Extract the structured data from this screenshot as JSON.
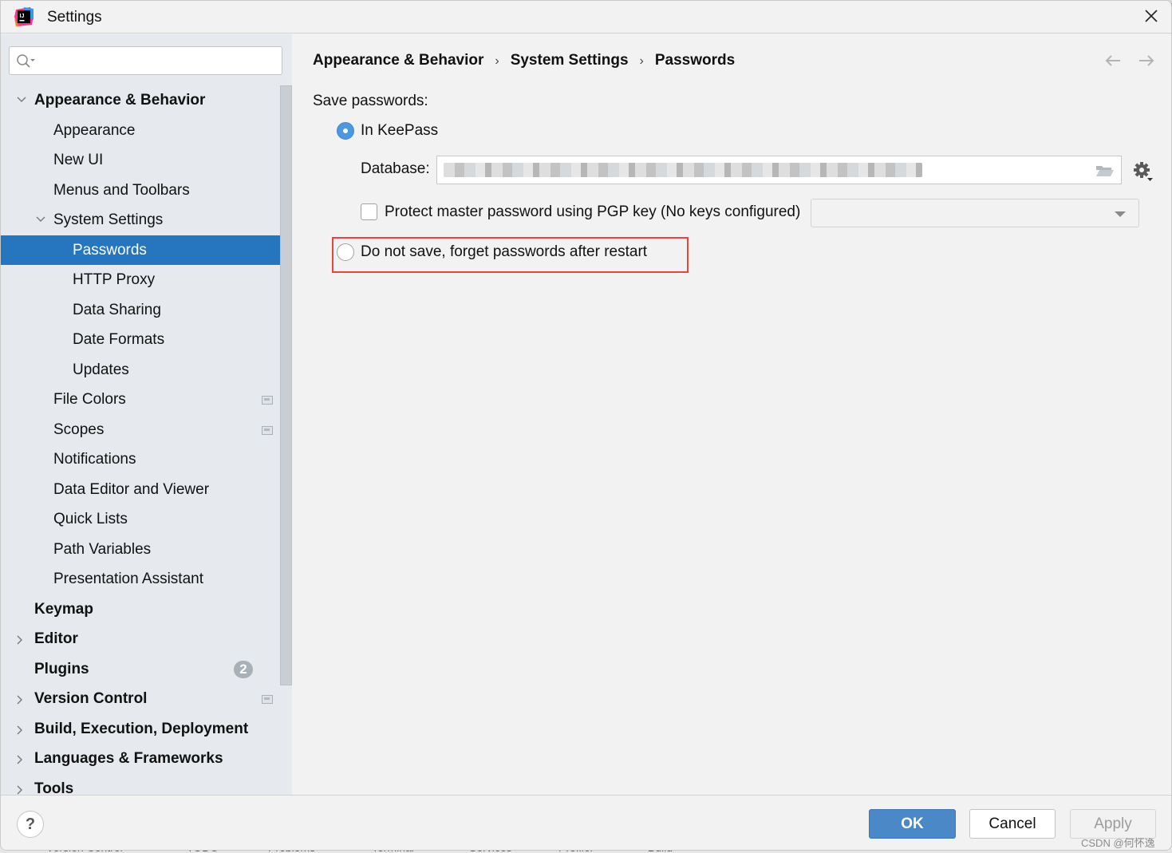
{
  "window": {
    "title": "Settings"
  },
  "search": {
    "value": "",
    "placeholder": ""
  },
  "sidebar": {
    "items": [
      {
        "label": "Appearance & Behavior",
        "level": 0,
        "bold": true,
        "expandable": true,
        "expanded": true
      },
      {
        "label": "Appearance",
        "level": 1
      },
      {
        "label": "New UI",
        "level": 1
      },
      {
        "label": "Menus and Toolbars",
        "level": 1
      },
      {
        "label": "System Settings",
        "level": 1,
        "expandable": true,
        "expanded": true
      },
      {
        "label": "Passwords",
        "level": 2,
        "selected": true
      },
      {
        "label": "HTTP Proxy",
        "level": 2
      },
      {
        "label": "Data Sharing",
        "level": 2
      },
      {
        "label": "Date Formats",
        "level": 2
      },
      {
        "label": "Updates",
        "level": 2
      },
      {
        "label": "File Colors",
        "level": 1,
        "project_icon": true
      },
      {
        "label": "Scopes",
        "level": 1,
        "project_icon": true
      },
      {
        "label": "Notifications",
        "level": 1
      },
      {
        "label": "Data Editor and Viewer",
        "level": 1
      },
      {
        "label": "Quick Lists",
        "level": 1
      },
      {
        "label": "Path Variables",
        "level": 1
      },
      {
        "label": "Presentation Assistant",
        "level": 1
      },
      {
        "label": "Keymap",
        "level": 0,
        "bold": true
      },
      {
        "label": "Editor",
        "level": 0,
        "bold": true,
        "expandable": true
      },
      {
        "label": "Plugins",
        "level": 0,
        "bold": true,
        "badge": "2"
      },
      {
        "label": "Version Control",
        "level": 0,
        "bold": true,
        "expandable": true,
        "project_icon": true
      },
      {
        "label": "Build, Execution, Deployment",
        "level": 0,
        "bold": true,
        "expandable": true
      },
      {
        "label": "Languages & Frameworks",
        "level": 0,
        "bold": true,
        "expandable": true
      },
      {
        "label": "Tools",
        "level": 0,
        "bold": true,
        "expandable": true
      }
    ]
  },
  "content": {
    "breadcrumb": [
      "Appearance & Behavior",
      "System Settings",
      "Passwords"
    ],
    "breadcrumb_separator": "›",
    "save_passwords_label": "Save passwords:",
    "options": {
      "keepass": {
        "label": "In KeePass",
        "selected": true
      },
      "database_label": "Database:",
      "database_value": "[redacted path]",
      "pgp_checkbox": {
        "label": "Protect master password using PGP key (No keys configured)",
        "checked": false
      },
      "pgp_select_value": "",
      "do_not_save": {
        "label": "Do not save, forget passwords after restart",
        "selected": false
      }
    }
  },
  "footer": {
    "help_label": "?",
    "ok_label": "OK",
    "cancel_label": "Cancel",
    "apply_label": "Apply",
    "watermark": "CSDN @何怀逸"
  },
  "background_toolwindows": [
    "Version Control",
    "TODO",
    "Problems",
    "Terminal",
    "Services",
    "Profiler",
    "Build"
  ],
  "colors": {
    "selection": "#2675bf",
    "primary_button": "#4a88c8",
    "radio_selected": "#4c97e0",
    "highlight_border": "#e8453c"
  }
}
